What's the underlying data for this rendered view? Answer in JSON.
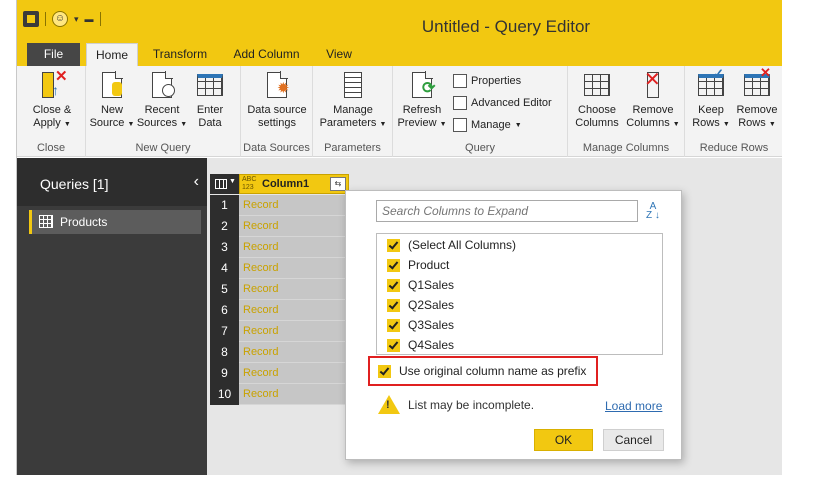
{
  "window": {
    "title": "Untitled - Query Editor"
  },
  "tabs": {
    "file": "File",
    "home": "Home",
    "transform": "Transform",
    "add_column": "Add Column",
    "view": "View"
  },
  "ribbon": {
    "close_group": {
      "label": "Close",
      "close_apply": [
        "Close &",
        "Apply"
      ]
    },
    "new_query_group": {
      "label": "New Query",
      "new_source": [
        "New",
        "Source"
      ],
      "recent_sources": [
        "Recent",
        "Sources"
      ],
      "enter_data": [
        "Enter",
        "Data"
      ]
    },
    "data_sources_group": {
      "label": "Data Sources",
      "settings": [
        "Data source",
        "settings"
      ]
    },
    "parameters_group": {
      "label": "Parameters",
      "manage": [
        "Manage",
        "Parameters"
      ]
    },
    "query_group": {
      "label": "Query",
      "refresh": [
        "Refresh",
        "Preview"
      ],
      "properties": "Properties",
      "advanced_editor": "Advanced Editor",
      "manage": "Manage"
    },
    "manage_columns_group": {
      "label": "Manage Columns",
      "choose": [
        "Choose",
        "Columns"
      ],
      "remove": [
        "Remove",
        "Columns"
      ]
    },
    "reduce_rows_group": {
      "label": "Reduce Rows",
      "keep": [
        "Keep",
        "Rows"
      ],
      "remove": [
        "Remove",
        "Rows"
      ]
    }
  },
  "queries_pane": {
    "title": "Queries [1]",
    "items": [
      "Products"
    ]
  },
  "grid": {
    "type_badge": [
      "ABC",
      "123"
    ],
    "column_name": "Column1",
    "rows": [
      {
        "num": "1",
        "value": "Record"
      },
      {
        "num": "2",
        "value": "Record"
      },
      {
        "num": "3",
        "value": "Record"
      },
      {
        "num": "4",
        "value": "Record"
      },
      {
        "num": "5",
        "value": "Record"
      },
      {
        "num": "6",
        "value": "Record"
      },
      {
        "num": "7",
        "value": "Record"
      },
      {
        "num": "8",
        "value": "Record"
      },
      {
        "num": "9",
        "value": "Record"
      },
      {
        "num": "10",
        "value": "Record"
      }
    ]
  },
  "expand_dialog": {
    "search_placeholder": "Search Columns to Expand",
    "sort_icon": "A-Z",
    "columns": [
      {
        "label": "(Select All Columns)",
        "checked": true
      },
      {
        "label": "Product",
        "checked": true
      },
      {
        "label": "Q1Sales",
        "checked": true
      },
      {
        "label": "Q2Sales",
        "checked": true
      },
      {
        "label": "Q3Sales",
        "checked": true
      },
      {
        "label": "Q4Sales",
        "checked": true
      }
    ],
    "prefix_option": {
      "label": "Use original column name as prefix",
      "checked": true
    },
    "warning": "List may be incomplete.",
    "load_more": "Load more",
    "ok": "OK",
    "cancel": "Cancel"
  },
  "colors": {
    "accent": "#f2c811",
    "dark": "#2d2d2d",
    "highlight": "#e02020",
    "link": "#2e6bb0"
  }
}
